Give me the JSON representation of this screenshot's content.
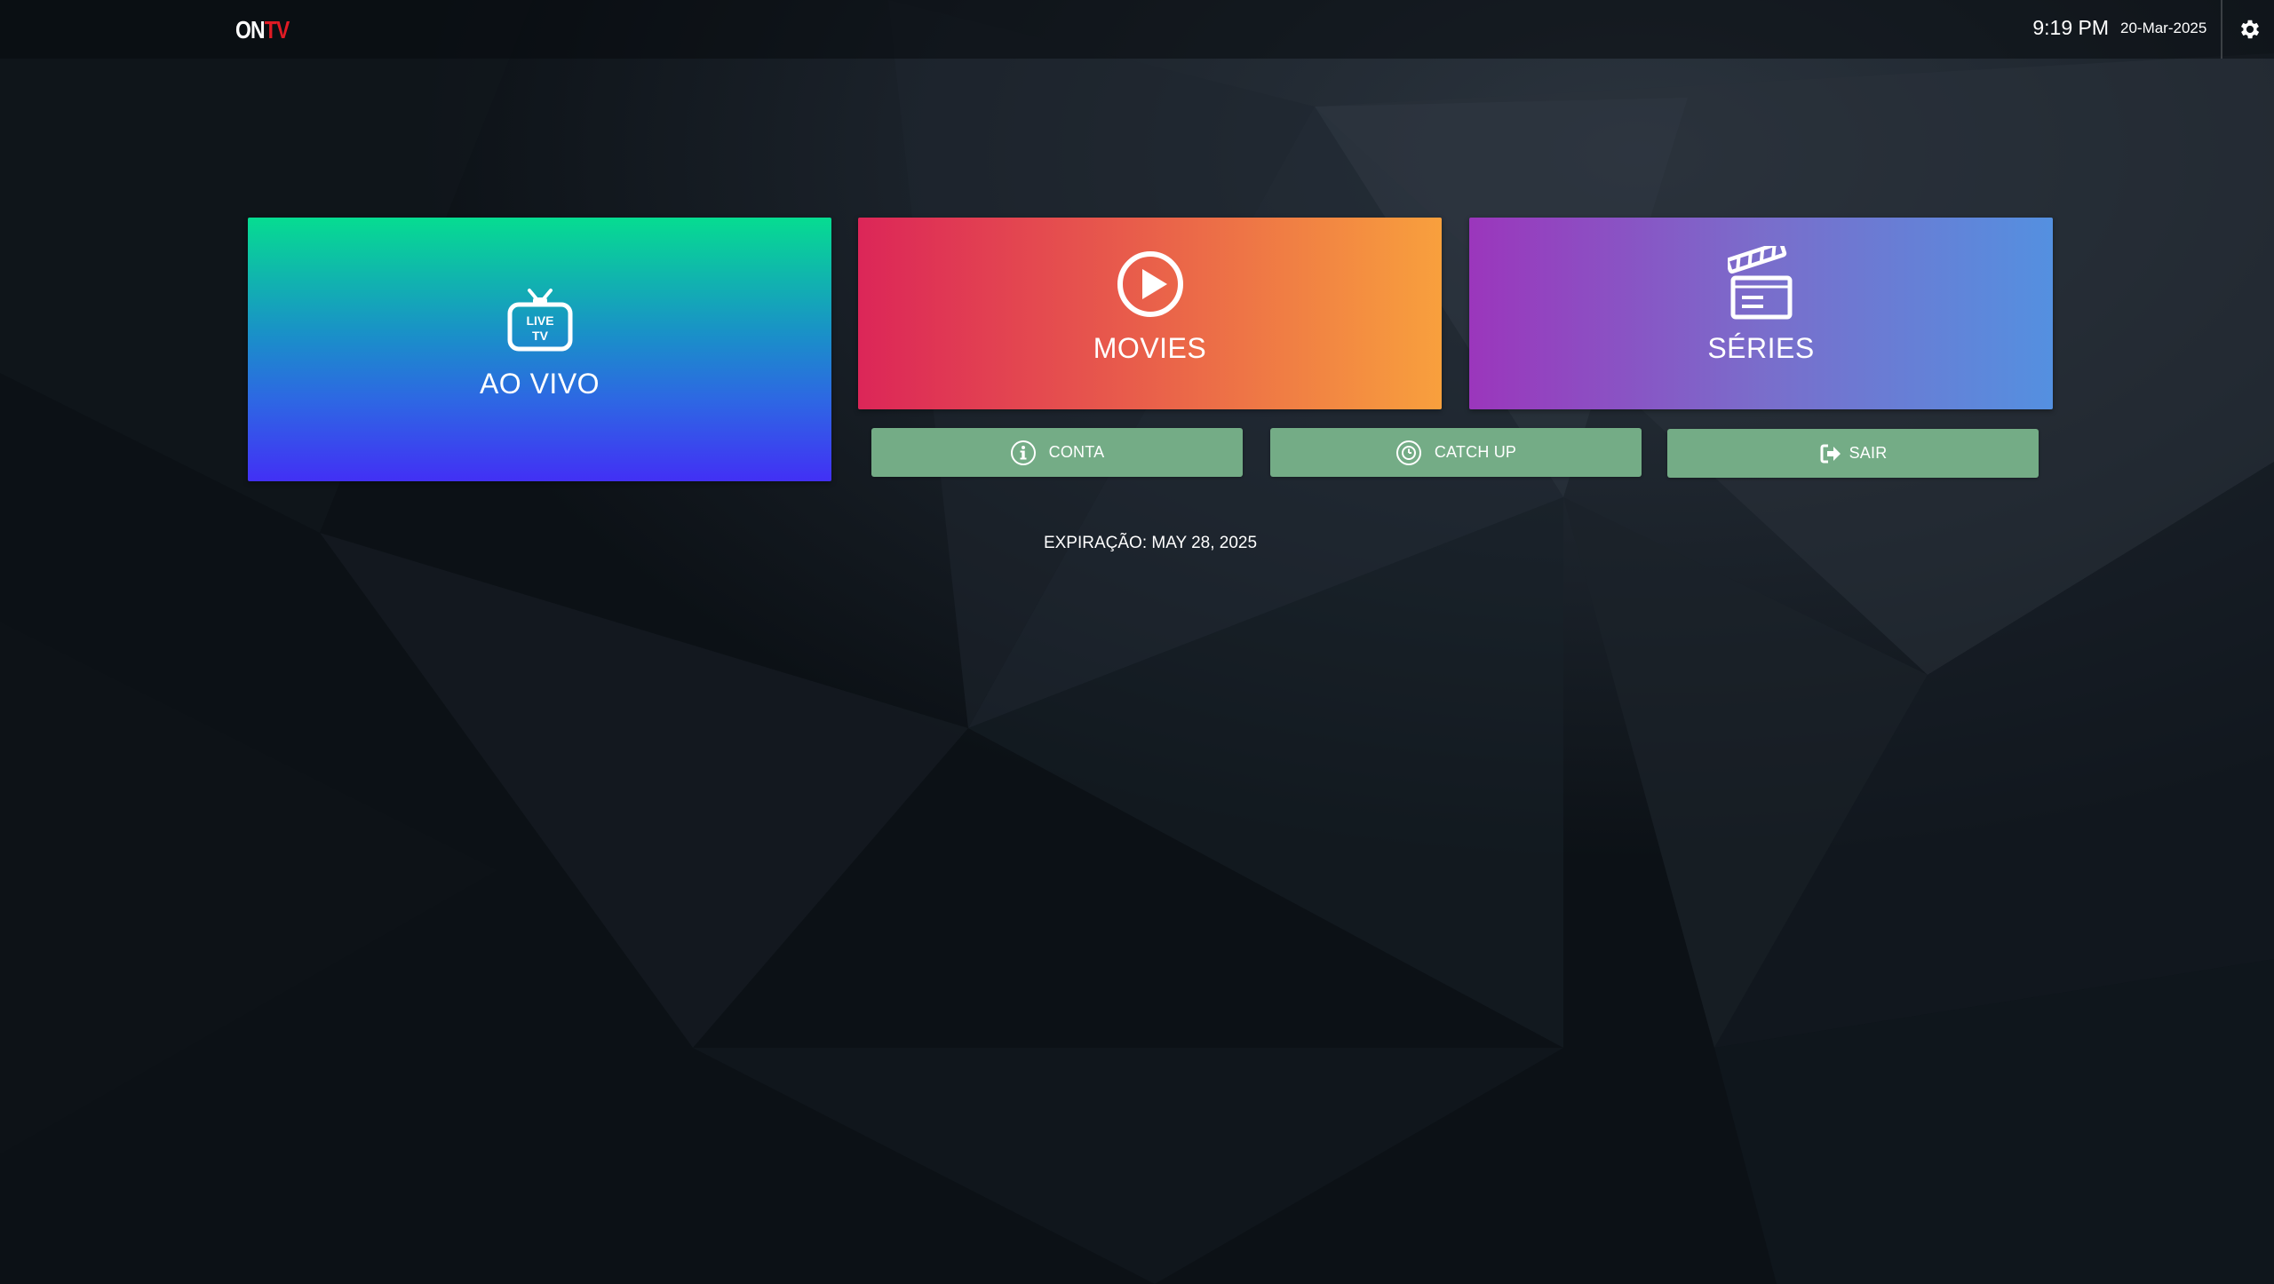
{
  "header": {
    "logo_on": "ON",
    "logo_tv": "TV",
    "time": "9:19 PM",
    "date": "20-Mar-2025",
    "settings_icon": "gear-icon"
  },
  "tiles": {
    "live": {
      "label": "AO VIVO",
      "icon": "live-tv-icon",
      "icon_text_1": "LIVE",
      "icon_text_2": "TV"
    },
    "movies": {
      "label": "MOVIES",
      "icon": "play-circle-icon"
    },
    "series": {
      "label": "SÉRIES",
      "icon": "clapperboard-icon"
    }
  },
  "buttons": {
    "conta": {
      "label": "CONTA",
      "icon": "info-circle-icon"
    },
    "catch_up": {
      "label": "CATCH UP",
      "icon": "clock-circle-icon"
    },
    "sair": {
      "label": "SAIR",
      "icon": "sign-out-icon"
    }
  },
  "expiry": "EXPIRAÇÃO: MAY 28, 2025",
  "colors": {
    "button": "#74ac86",
    "logo_accent": "#e01b24",
    "background": "#10161c"
  }
}
